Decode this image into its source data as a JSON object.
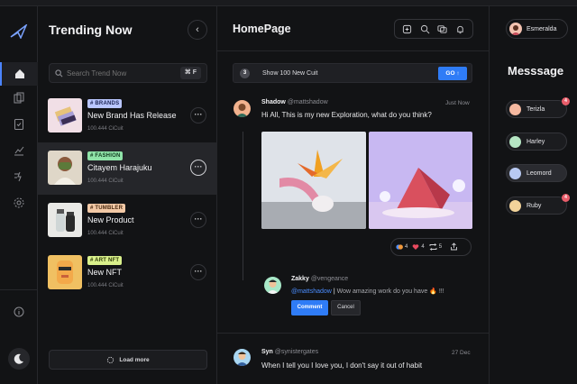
{
  "trending": {
    "title": "Trending Now",
    "search_placeholder": "Search Trend Now",
    "shortcut": "⌘ F",
    "load_more": "Load more",
    "items": [
      {
        "tag": "# BRANDS",
        "name": "New Brand Has Release",
        "count": "100.444 CiCuit",
        "tag_bg": "#b9c6ff",
        "tag_fg": "#1a2250"
      },
      {
        "tag": "# FASHION",
        "name": "Citayem Harajuku",
        "count": "100.444 CiCuit",
        "tag_bg": "#8fe3a8",
        "tag_fg": "#123a1f"
      },
      {
        "tag": "# TUMBLER",
        "name": "New Product",
        "count": "100.444 CiCuit",
        "tag_bg": "#f3c9a6",
        "tag_fg": "#4a2a10"
      },
      {
        "tag": "# ART NFT",
        "name": "New NFT",
        "count": "100.444 CiCuit",
        "tag_bg": "#d9f08b",
        "tag_fg": "#2e3a08"
      }
    ]
  },
  "home": {
    "title": "HomePage",
    "new_count": "3",
    "new_label": "Show 100 New Cuit",
    "go_label": "GO ↑",
    "post": {
      "author": "Shadow",
      "handle": "@mattshadow",
      "time": "Just Now",
      "text": "Hi All, This is my new Exploration, what do you think?",
      "reacts": [
        {
          "icon": "emoji",
          "count": "4"
        },
        {
          "icon": "heart",
          "count": "4"
        },
        {
          "icon": "repost",
          "count": "5"
        }
      ]
    },
    "reply": {
      "author": "Zakky",
      "handle": "@vengeance",
      "mention": "@mattshadow",
      "text": "Wow amazing work do you have 🔥 !!!",
      "comment_label": "Comment",
      "cancel_label": "Cancel"
    },
    "post2": {
      "author": "Syn",
      "handle": "@synistergates",
      "time": "27 Dec",
      "text": "When I tell you I love you, I don't say it out of habit"
    }
  },
  "user": {
    "name": "Esmeralda"
  },
  "messages": {
    "title": "Messsage",
    "contacts": [
      {
        "name": "Terizla",
        "badge": "4"
      },
      {
        "name": "Harley",
        "badge": ""
      },
      {
        "name": "Leomord",
        "badge": ""
      },
      {
        "name": "Ruby",
        "badge": "4"
      }
    ]
  },
  "colors": {
    "accent": "#2f7cf6",
    "badge": "#e85d6a",
    "mention": "#4b8dff"
  }
}
